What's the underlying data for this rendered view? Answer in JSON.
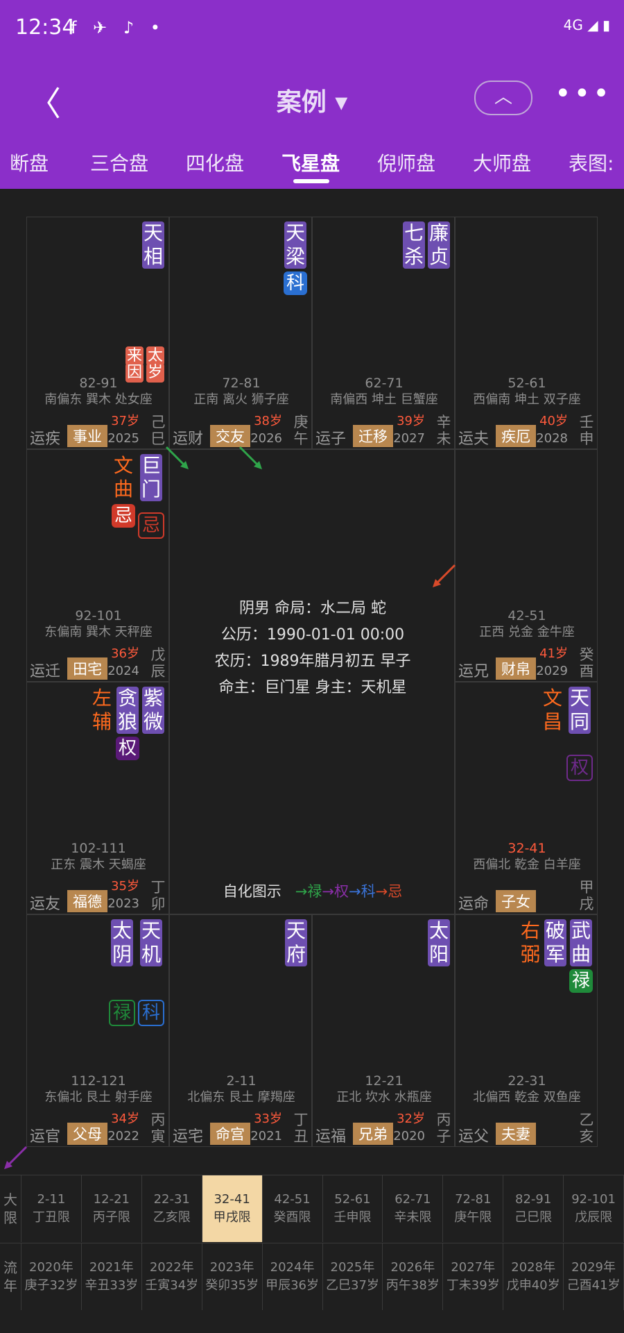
{
  "status": {
    "time": "12:34",
    "icons": "f ✈ ♪ •",
    "right": "4G ◢ ▮"
  },
  "header": {
    "back": "〈",
    "title": "案例 ▾",
    "up": "︿",
    "more": "•••"
  },
  "tabs": [
    "断盘",
    "三合盘",
    "四化盘",
    "飞星盘",
    "倪师盘",
    "大师盘",
    "表图:"
  ],
  "cells": [
    {
      "pos": "r0c0",
      "stars": [
        [
          "天",
          "相"
        ]
      ],
      "hua": [],
      "taisui": [
        "来",
        "因",
        "太",
        "岁"
      ],
      "range": "82-91",
      "fang": "南偏东 巽木 处女座",
      "age": "37岁",
      "year": "2025",
      "gz": [
        "己",
        "巳"
      ],
      "yun": "运疾",
      "gong": "事业"
    },
    {
      "pos": "r0c1",
      "stars": [
        [
          "天",
          "梁"
        ]
      ],
      "hua": [
        "科"
      ],
      "range": "72-81",
      "fang": "正南 离火 狮子座",
      "age": "38岁",
      "year": "2026",
      "gz": [
        "庚",
        "午"
      ],
      "yun": "运财",
      "gong": "交友"
    },
    {
      "pos": "r0c2",
      "stars": [
        [
          "廉",
          "贞"
        ],
        [
          "七",
          "杀"
        ]
      ],
      "range": "62-71",
      "fang": "南偏西 坤土 巨蟹座",
      "age": "39岁",
      "year": "2027",
      "gz": [
        "辛",
        "未"
      ],
      "yun": "运子",
      "gong": "迁移"
    },
    {
      "pos": "r0c3",
      "stars": [],
      "range": "52-61",
      "fang": "西偏南 坤土 双子座",
      "age": "40岁",
      "year": "2028",
      "gz": [
        "壬",
        "申"
      ],
      "yun": "运夫",
      "gong": "疾厄"
    },
    {
      "pos": "r1c0",
      "range": "92-101",
      "fang": "东偏南 巽木 天秤座",
      "age": "36岁",
      "year": "2024",
      "gz": [
        "戊",
        "辰"
      ],
      "yun": "运迁",
      "gong": "田宅"
    },
    {
      "pos": "r1c3",
      "range": "42-51",
      "fang": "正西 兑金 金牛座",
      "age": "41岁",
      "year": "2029",
      "gz": [
        "癸",
        "酉"
      ],
      "yun": "运兄",
      "gong": "财帛"
    },
    {
      "pos": "r2c0",
      "range": "102-111",
      "fang": "正东 震木 天蝎座",
      "age": "35岁",
      "year": "2023",
      "gz": [
        "丁",
        "卯"
      ],
      "yun": "运友",
      "gong": "福德"
    },
    {
      "pos": "r2c3",
      "range": "32-41",
      "fang": "西偏北 乾金 白羊座",
      "age": "",
      "year": "",
      "gz": [
        "甲",
        "戌"
      ],
      "yun": "运命",
      "gong": "子女"
    },
    {
      "pos": "r3c0",
      "range": "112-121",
      "fang": "东偏北 艮土 射手座",
      "age": "34岁",
      "year": "2022",
      "gz": [
        "丙",
        "寅"
      ],
      "yun": "运官",
      "gong": "父母"
    },
    {
      "pos": "r3c1",
      "range": "2-11",
      "fang": "北偏东 艮土 摩羯座",
      "age": "33岁",
      "year": "2021",
      "gz": [
        "丁",
        "丑"
      ],
      "yun": "运宅",
      "gong": "命宫"
    },
    {
      "pos": "r3c2",
      "range": "12-21",
      "fang": "正北 坎水 水瓶座",
      "age": "32岁",
      "year": "2020",
      "gz": [
        "丙",
        "子"
      ],
      "yun": "运福",
      "gong": "兄弟"
    },
    {
      "pos": "r3c3",
      "range": "22-31",
      "fang": "北偏西 乾金 双鱼座",
      "age": "",
      "year": "",
      "gz": [
        "乙",
        "亥"
      ],
      "yun": "运父",
      "gong": "夫妻"
    }
  ],
  "stars_extra": {
    "r1c0": {
      "s1": [
        "巨",
        "门"
      ],
      "s2": [
        "文",
        "曲"
      ],
      "h1": "忌",
      "h2": "忌"
    },
    "r2c0": {
      "s1": [
        "紫",
        "微"
      ],
      "s2": [
        "贪",
        "狼"
      ],
      "s3": [
        "左",
        "辅"
      ],
      "h1": "权"
    },
    "r2c3": {
      "s1": [
        "天",
        "同"
      ],
      "s2": [
        "文",
        "昌"
      ],
      "h1": "权",
      "range_color": "#ff5a3c"
    },
    "r3c0": {
      "s1": [
        "天",
        "机"
      ],
      "s2": [
        "太",
        "阴"
      ],
      "h1": "科",
      "h2": "禄"
    },
    "r3c1": {
      "s1": [
        "天",
        "府"
      ]
    },
    "r3c2": {
      "s1": [
        "太",
        "阳"
      ]
    },
    "r3c3": {
      "s1": [
        "武",
        "曲"
      ],
      "s2": [
        "破",
        "军"
      ],
      "s3": [
        "右",
        "弼"
      ],
      "h1": "禄"
    }
  },
  "center": {
    "line1": "阴男 命局：水二局 蛇",
    "line2": "公历：1990-01-01 00:00",
    "line3": "农历：1989年腊月初五 早子",
    "line4": "命主：巨门星 身主：天机星",
    "legend_label": "自化图示",
    "legend": {
      "lu": "→禄",
      "quan": "→权",
      "ke": "→科",
      "ji": "→忌"
    }
  },
  "timeline": {
    "dax_label": [
      "大",
      "限"
    ],
    "dax": [
      {
        "a": "2-11",
        "b": "丁丑限"
      },
      {
        "a": "12-21",
        "b": "丙子限"
      },
      {
        "a": "22-31",
        "b": "乙亥限"
      },
      {
        "a": "32-41",
        "b": "甲戌限",
        "active": true
      },
      {
        "a": "42-51",
        "b": "癸酉限"
      },
      {
        "a": "52-61",
        "b": "壬申限"
      },
      {
        "a": "62-71",
        "b": "辛未限"
      },
      {
        "a": "72-81",
        "b": "庚午限"
      },
      {
        "a": "82-91",
        "b": "己巳限"
      },
      {
        "a": "92-101",
        "b": "戊辰限"
      }
    ],
    "liu_label": [
      "流",
      "年"
    ],
    "liu": [
      {
        "a": "2020年",
        "b": "庚子32岁"
      },
      {
        "a": "2021年",
        "b": "辛丑33岁"
      },
      {
        "a": "2022年",
        "b": "壬寅34岁"
      },
      {
        "a": "2023年",
        "b": "癸卯35岁"
      },
      {
        "a": "2024年",
        "b": "甲辰36岁"
      },
      {
        "a": "2025年",
        "b": "乙巳37岁"
      },
      {
        "a": "2026年",
        "b": "丙午38岁"
      },
      {
        "a": "2027年",
        "b": "丁未39岁"
      },
      {
        "a": "2028年",
        "b": "戊申40岁"
      },
      {
        "a": "2029年",
        "b": "己酉41岁"
      }
    ]
  }
}
